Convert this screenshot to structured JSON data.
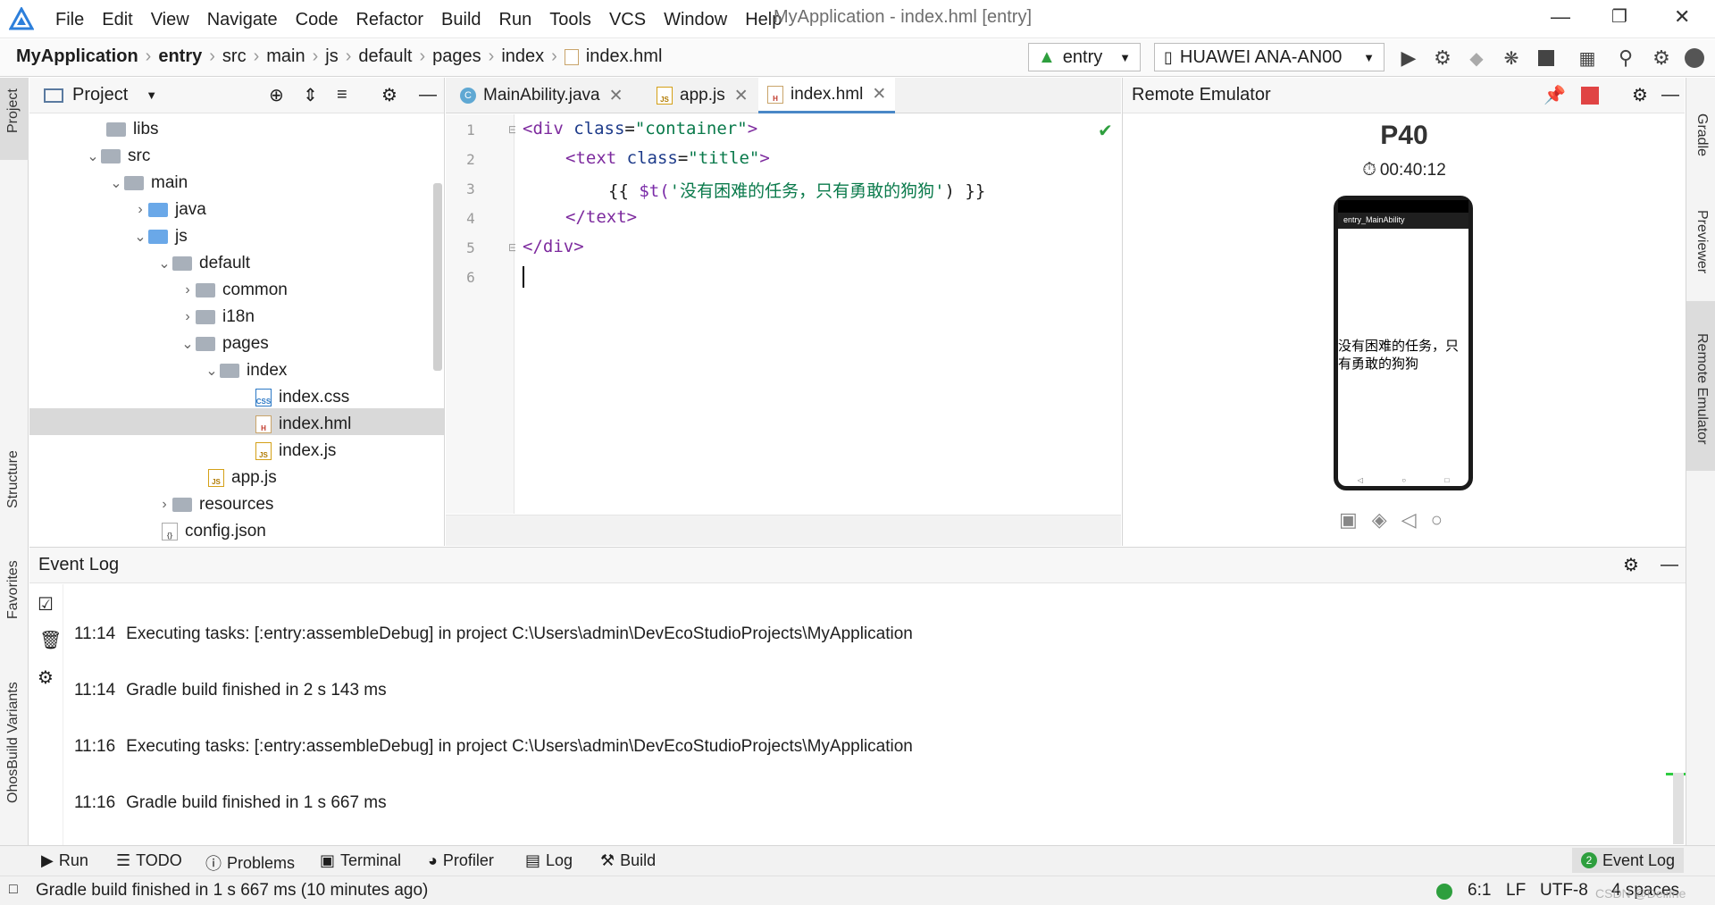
{
  "menubar": {
    "items": [
      "File",
      "Edit",
      "View",
      "Navigate",
      "Code",
      "Refactor",
      "Build",
      "Run",
      "Tools",
      "VCS",
      "Window",
      "Help"
    ],
    "window_title": "MyApplication - index.hml [entry]"
  },
  "navbar": {
    "breadcrumbs": [
      "MyApplication",
      "entry",
      "src",
      "main",
      "js",
      "default",
      "pages",
      "index",
      "index.hml"
    ],
    "run_config": "entry",
    "device": "HUAWEI ANA-AN00"
  },
  "left_stripe": {
    "project": "Project",
    "structure": "Structure",
    "favorites": "Favorites",
    "build_variants": "OhosBuild Variants"
  },
  "right_stripe": {
    "gradle": "Gradle",
    "previewer": "Previewer",
    "remote_emulator": "Remote Emulator"
  },
  "project_panel": {
    "title": "Project",
    "tree": [
      {
        "label": "libs",
        "type": "folder"
      },
      {
        "label": "src",
        "type": "folder"
      },
      {
        "label": "main",
        "type": "folder"
      },
      {
        "label": "java",
        "type": "folder-blue"
      },
      {
        "label": "js",
        "type": "folder-blue"
      },
      {
        "label": "default",
        "type": "folder"
      },
      {
        "label": "common",
        "type": "folder"
      },
      {
        "label": "i18n",
        "type": "folder"
      },
      {
        "label": "pages",
        "type": "folder"
      },
      {
        "label": "index",
        "type": "folder"
      },
      {
        "label": "index.css",
        "type": "css"
      },
      {
        "label": "index.hml",
        "type": "hml"
      },
      {
        "label": "index.js",
        "type": "js"
      },
      {
        "label": "app.js",
        "type": "js"
      },
      {
        "label": "resources",
        "type": "folder"
      },
      {
        "label": "config.json",
        "type": "json"
      }
    ]
  },
  "editor": {
    "tabs": [
      {
        "label": "MainAbility.java"
      },
      {
        "label": "app.js"
      },
      {
        "label": "index.hml"
      }
    ],
    "line_numbers": [
      "1",
      "2",
      "3",
      "4",
      "5",
      "6"
    ],
    "code": {
      "l1_open": "<div ",
      "l1_attr": "class",
      "l1_eq": "=",
      "l1_str": "\"container\"",
      "l1_close": ">",
      "l2_open": "<text ",
      "l2_attr": "class",
      "l2_eq": "=",
      "l2_str": "\"title\"",
      "l2_close": ">",
      "l3_open": "{{ ",
      "l3_func": "$t(",
      "l3_str": "'没有困难的任务，只有勇敢的狗狗'",
      "l3_close": ") }}",
      "l4": "</text>",
      "l5": "</div>"
    }
  },
  "emulator": {
    "title": "Remote Emulator",
    "device_name": "P40",
    "timer": "00:40:12",
    "app_title": "entry_MainAbility",
    "screen_text": "没有困难的任务，只有勇敢的狗狗"
  },
  "event_log": {
    "title": "Event Log",
    "entries": [
      {
        "time": "11:14",
        "msg": "Executing tasks: [:entry:assembleDebug] in project C:\\Users\\admin\\DevEcoStudioProjects\\MyApplication"
      },
      {
        "time": "11:14",
        "msg": "Gradle build finished in 2 s 143 ms"
      },
      {
        "time": "11:16",
        "msg": "Executing tasks: [:entry:assembleDebug] in project C:\\Users\\admin\\DevEcoStudioProjects\\MyApplication"
      },
      {
        "time": "11:16",
        "msg": "Gradle build finished in 1 s 667 ms"
      }
    ]
  },
  "bottom_tabs": {
    "run": "Run",
    "todo": "TODO",
    "problems": "Problems",
    "terminal": "Terminal",
    "profiler": "Profiler",
    "log": "Log",
    "build": "Build",
    "event_log": "Event Log",
    "event_count": "2"
  },
  "status": {
    "message": "Gradle build finished in 1 s 667 ms (10 minutes ago)",
    "position": "6:1",
    "line_sep": "LF",
    "encoding": "UTF-8",
    "indent": "4 spaces",
    "watermark": "CSDN @Deiifne"
  },
  "colors": {
    "accent": "#4a88c7",
    "run_green": "#2e9f3e",
    "stop_red": "#e04444"
  }
}
